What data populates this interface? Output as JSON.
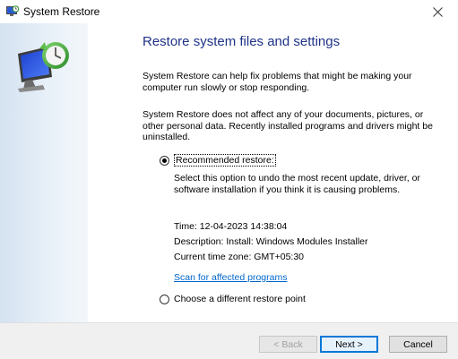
{
  "window": {
    "title": "System Restore"
  },
  "content": {
    "heading": "Restore system files and settings",
    "para1": "System Restore can help fix problems that might be making your computer run slowly or stop responding.",
    "para2": "System Restore does not affect any of your documents, pictures, or other personal data. Recently installed programs and drivers might be uninstalled."
  },
  "options": {
    "recommended_label": "Recommended restore:",
    "recommended_selected": true,
    "recommended_desc": "Select this option to undo the most recent update, driver, or software installation if you think it is causing problems.",
    "time": "Time: 12-04-2023 14:38:04",
    "description": "Description: Install: Windows Modules Installer",
    "timezone": "Current time zone: GMT+05:30",
    "scan_link": "Scan for affected programs",
    "different_label": "Choose a different restore point",
    "different_selected": false
  },
  "buttons": {
    "back": "< Back",
    "next": "Next >",
    "cancel": "Cancel"
  },
  "colors": {
    "heading": "#1e3287",
    "link": "#0066cc",
    "primary_border": "#0078d7"
  },
  "icons": {
    "app": "system-restore-icon",
    "close": "close-icon",
    "banner": "system-restore-monitor-icon"
  }
}
